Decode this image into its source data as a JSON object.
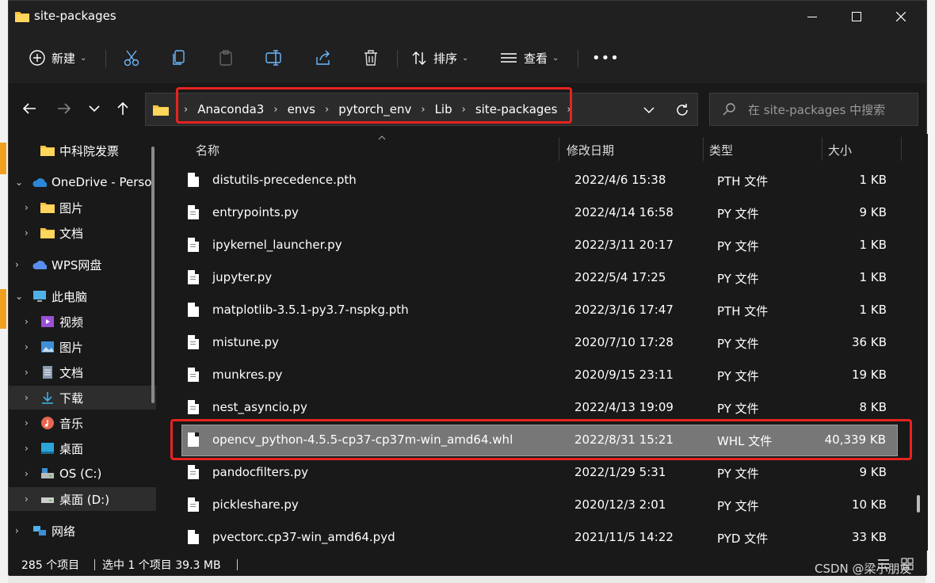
{
  "window": {
    "title": "site-packages",
    "minimize_icon": "minimize-icon",
    "maximize_icon": "maximize-icon",
    "close_icon": "close-icon"
  },
  "toolbar": {
    "new_label": "新建",
    "sort_label": "排序",
    "view_label": "查看",
    "more_label": "•••"
  },
  "address": {
    "crumbs": [
      "Anaconda3",
      "envs",
      "pytorch_env",
      "Lib",
      "site-packages"
    ],
    "search_placeholder": "在 site-packages 中搜索"
  },
  "nav": {
    "items": [
      {
        "label": "中科院发票"
      },
      {
        "label": "OneDrive - Perso"
      },
      {
        "label": "图片"
      },
      {
        "label": "文档"
      },
      {
        "label": "WPS网盘"
      },
      {
        "label": "此电脑"
      },
      {
        "label": "视频"
      },
      {
        "label": "图片"
      },
      {
        "label": "文档"
      },
      {
        "label": "下载"
      },
      {
        "label": "音乐"
      },
      {
        "label": "桌面"
      },
      {
        "label": "OS (C:)"
      },
      {
        "label": "桌面 (D:)"
      },
      {
        "label": "网络"
      }
    ]
  },
  "columns": {
    "name": "名称",
    "modified": "修改日期",
    "type": "类型",
    "size": "大小"
  },
  "files": [
    {
      "name": "distutils-precedence.pth",
      "date": "2022/4/6 15:38",
      "type": "PTH 文件",
      "size": "1 KB"
    },
    {
      "name": "entrypoints.py",
      "date": "2022/4/14 16:58",
      "type": "PY 文件",
      "size": "9 KB"
    },
    {
      "name": "ipykernel_launcher.py",
      "date": "2022/3/11 20:17",
      "type": "PY 文件",
      "size": "1 KB"
    },
    {
      "name": "jupyter.py",
      "date": "2022/5/4 17:25",
      "type": "PY 文件",
      "size": "1 KB"
    },
    {
      "name": "matplotlib-3.5.1-py3.7-nspkg.pth",
      "date": "2022/3/16 17:47",
      "type": "PTH 文件",
      "size": "1 KB"
    },
    {
      "name": "mistune.py",
      "date": "2020/7/10 17:28",
      "type": "PY 文件",
      "size": "36 KB"
    },
    {
      "name": "munkres.py",
      "date": "2020/9/15 23:11",
      "type": "PY 文件",
      "size": "19 KB"
    },
    {
      "name": "nest_asyncio.py",
      "date": "2022/4/13 19:09",
      "type": "PY 文件",
      "size": "8 KB"
    },
    {
      "name": "opencv_python-4.5.5-cp37-cp37m-win_amd64.whl",
      "date": "2022/8/31 15:21",
      "type": "WHL 文件",
      "size": "40,339 KB"
    },
    {
      "name": "pandocfilters.py",
      "date": "2022/1/29 5:31",
      "type": "PY 文件",
      "size": "9 KB"
    },
    {
      "name": "pickleshare.py",
      "date": "2020/12/3 2:01",
      "type": "PY 文件",
      "size": "10 KB"
    },
    {
      "name": "pvectorc.cp37-win_amd64.pyd",
      "date": "2021/11/5 14:22",
      "type": "PYD 文件",
      "size": "33 KB"
    }
  ],
  "status": {
    "count": "285 个项目",
    "selection": "选中 1 个项目  39.3 MB"
  },
  "watermark": "CSDN @梁小朋友",
  "colors": {
    "highlight": "#e8231f",
    "window_bg": "#191919",
    "selected_row": "#777777"
  }
}
